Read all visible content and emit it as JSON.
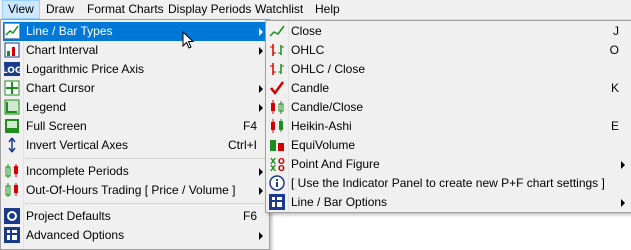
{
  "menubar": {
    "items": [
      "View",
      "Draw",
      "Format Charts",
      "Display Periods",
      "Watchlist",
      "Help"
    ]
  },
  "view_menu": {
    "items": [
      {
        "label": "Line / Bar Types",
        "icon": "line-chart-icon",
        "submenu": true,
        "highlighted": true
      },
      {
        "label": "Chart Interval",
        "icon": "chart-interval-icon",
        "submenu": true
      },
      {
        "label": "Logarithmic Price Axis",
        "icon": "log-axis-icon"
      },
      {
        "label": "Chart Cursor",
        "icon": "crosshair-icon",
        "submenu": true
      },
      {
        "label": "Legend",
        "icon": "legend-icon",
        "submenu": true
      },
      {
        "label": "Full Screen",
        "icon": "full-screen-icon",
        "shortcut": "F4"
      },
      {
        "label": "Invert Vertical Axes",
        "icon": "invert-axes-icon",
        "shortcut": "Ctrl+I"
      },
      {
        "label": "Incomplete Periods",
        "icon": "incomplete-periods-icon",
        "submenu": true
      },
      {
        "label": "Out-Of-Hours Trading  [ Price / Volume ]",
        "icon": "out-of-hours-icon",
        "submenu": true
      },
      {
        "label": "Project Defaults",
        "icon": "project-defaults-icon",
        "shortcut": "F6"
      },
      {
        "label": "Advanced Options",
        "icon": "advanced-options-icon",
        "submenu": true
      }
    ]
  },
  "line_bar_menu": {
    "items": [
      {
        "label": "Close",
        "icon": "close-line-icon",
        "shortcut": "J"
      },
      {
        "label": "OHLC",
        "icon": "ohlc-icon",
        "shortcut": "O"
      },
      {
        "label": "OHLC / Close",
        "icon": "ohlc-close-icon"
      },
      {
        "label": "Candle",
        "icon": "checkmark-icon",
        "shortcut": "K",
        "checked": true
      },
      {
        "label": "Candle/Close",
        "icon": "candle-close-icon"
      },
      {
        "label": "Heikin-Ashi",
        "icon": "heikin-ashi-icon",
        "shortcut": "E"
      },
      {
        "label": "EquiVolume",
        "icon": "equivolume-icon"
      },
      {
        "label": "Point And Figure",
        "icon": "point-and-figure-icon",
        "submenu": true
      },
      {
        "label": "[ Use the Indicator Panel to create new P+F chart settings ]",
        "icon": "info-icon"
      },
      {
        "label": "Line / Bar Options",
        "icon": "options-icon",
        "submenu": true
      }
    ]
  },
  "colors": {
    "highlight": "#0078d7",
    "menu_bg": "#f0f0f0",
    "green": "#1e8c1e",
    "red": "#d40000",
    "navy": "#1a3a8c"
  }
}
